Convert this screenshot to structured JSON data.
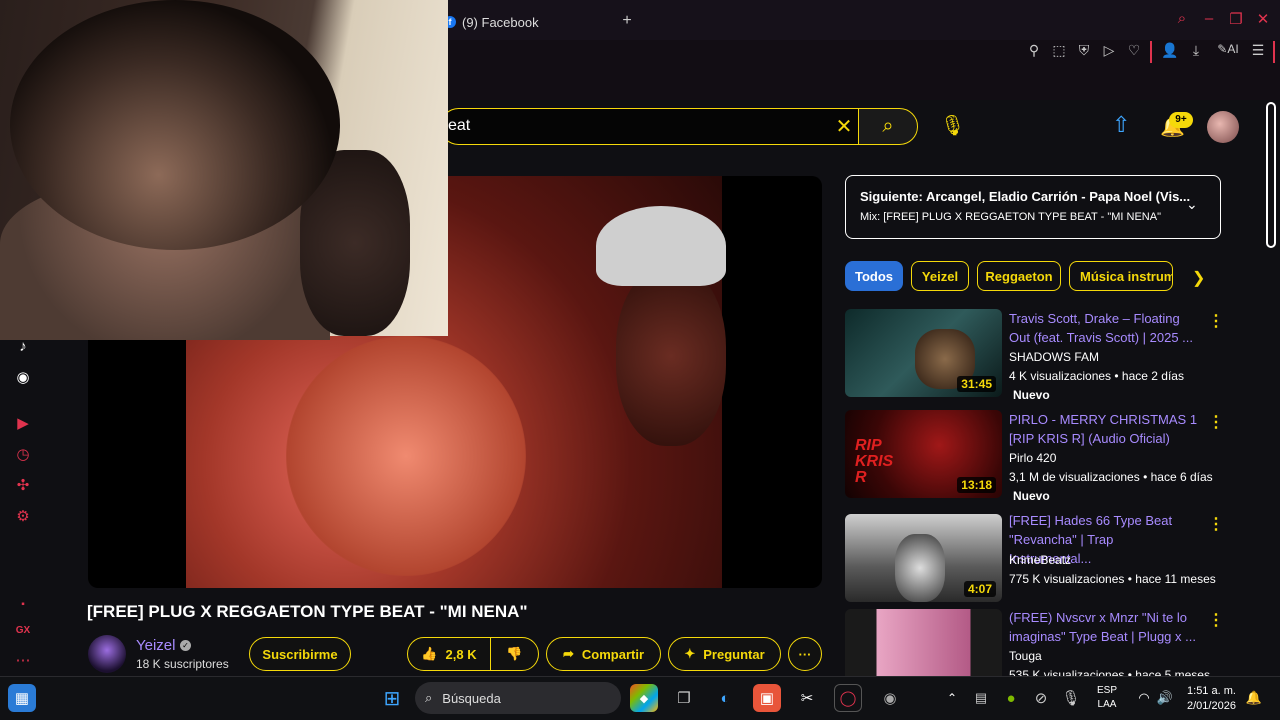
{
  "browser": {
    "tab_title": "(9) Facebook",
    "facebook_icon_glyph": "f",
    "new_tab_glyph": "+",
    "ai_label": "AI"
  },
  "youtube": {
    "search_value": "eat",
    "notifications_badge": "9+",
    "upnext": {
      "title": "Siguiente: Arcangel, Eladio Carrión - Papa Noel (Vis...",
      "subtitle": "Mix: [FREE] PLUG X REGGAETON TYPE BEAT - \"MI NENA\""
    },
    "chips": [
      "Todos",
      "Yeizel",
      "Reggaeton",
      "Música instrum"
    ],
    "video": {
      "title": "[FREE] PLUG X REGGAETON TYPE BEAT - \"MI NENA\"",
      "channel": "Yeizel",
      "subscribers": "18 K suscriptores",
      "subscribe_label": "Suscribirme",
      "likes": "2,8 K",
      "share_label": "Compartir",
      "ask_label": "Preguntar",
      "more_glyph": "···"
    },
    "recommendations": [
      {
        "title": "Travis Scott, Drake –  Floating Out (feat. Travis Scott) | 2025 ...",
        "channel": "SHADOWS FAM",
        "meta": "4 K visualizaciones • hace 2 días",
        "badge": "Nuevo",
        "duration": "31:45"
      },
      {
        "title": "PIRLO - MERRY CHRISTMAS 1 [RIP KRIS R] (Audio Oficial)",
        "channel": "Pirlo 420",
        "meta": "3,1 M de visualizaciones • hace 6 días",
        "badge": "Nuevo",
        "duration": "13:18",
        "thumb_text": "RIP KRIS R"
      },
      {
        "title": "[FREE] Hades 66 Type Beat \"Revancha\" | Trap Instrumental...",
        "channel": "KrimeBeatz",
        "meta": "775 K visualizaciones • hace 11 meses",
        "duration": "4:07"
      },
      {
        "title": "(FREE) Nvscvr x Mnzr \"Ni te lo imaginas\" Type Beat | Plugg x ...",
        "channel": "Touga",
        "meta": "535 K visualizaciones • hace 5 meses"
      }
    ]
  },
  "taskbar": {
    "search_placeholder": "Búsqueda",
    "lang_line1": "ESP",
    "lang_line2": "LAA",
    "time": "1:51 a. m.",
    "date": "2/01/2026"
  },
  "colors": {
    "accent_yellow": "#f5d90a",
    "opera_red": "#e0334e",
    "link_purple": "#a88bff",
    "chip_active": "#2a6fd6"
  }
}
